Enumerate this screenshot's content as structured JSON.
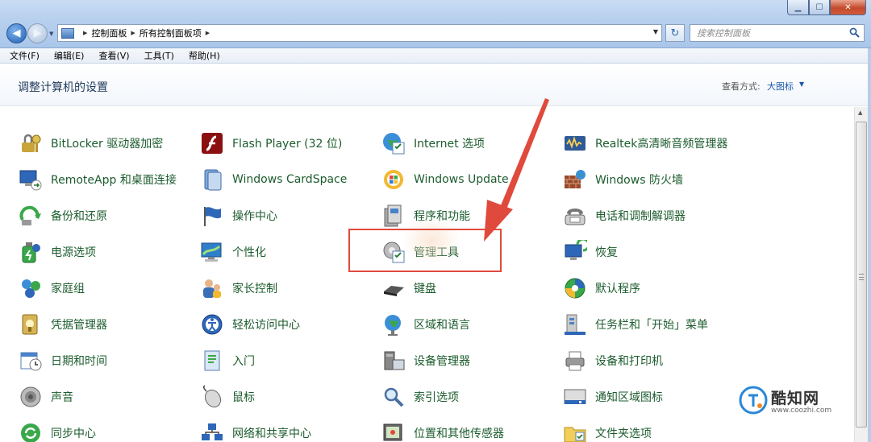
{
  "window": {
    "minimize_glyph": "▁",
    "maximize_glyph": "☐",
    "close_glyph": "✕"
  },
  "address": {
    "crumbs": [
      "控制面板",
      "所有控制面板项"
    ],
    "search_placeholder": "搜索控制面板"
  },
  "menu": [
    "文件(F)",
    "编辑(E)",
    "查看(V)",
    "工具(T)",
    "帮助(H)"
  ],
  "header": {
    "title": "调整计算机的设置",
    "view_by_label": "查看方式:",
    "view_by_value": "大图标"
  },
  "items": [
    {
      "label": "BitLocker 驱动器加密",
      "icon": "bitlocker-icon"
    },
    {
      "label": "Flash Player (32 位)",
      "icon": "flash-player-icon"
    },
    {
      "label": "Internet 选项",
      "icon": "internet-options-icon"
    },
    {
      "label": "Realtek高清晰音频管理器",
      "icon": "realtek-audio-icon"
    },
    {
      "label": "RemoteApp 和桌面连接",
      "icon": "remoteapp-icon"
    },
    {
      "label": "Windows CardSpace",
      "icon": "cardspace-icon"
    },
    {
      "label": "Windows Update",
      "icon": "windows-update-icon"
    },
    {
      "label": "Windows 防火墙",
      "icon": "firewall-icon"
    },
    {
      "label": "备份和还原",
      "icon": "backup-restore-icon"
    },
    {
      "label": "操作中心",
      "icon": "action-center-icon"
    },
    {
      "label": "程序和功能",
      "icon": "programs-features-icon"
    },
    {
      "label": "电话和调制解调器",
      "icon": "phone-modem-icon"
    },
    {
      "label": "电源选项",
      "icon": "power-options-icon"
    },
    {
      "label": "个性化",
      "icon": "personalization-icon"
    },
    {
      "label": "管理工具",
      "icon": "admin-tools-icon"
    },
    {
      "label": "恢复",
      "icon": "recovery-icon"
    },
    {
      "label": "家庭组",
      "icon": "homegroup-icon"
    },
    {
      "label": "家长控制",
      "icon": "parental-controls-icon"
    },
    {
      "label": "键盘",
      "icon": "keyboard-icon"
    },
    {
      "label": "默认程序",
      "icon": "default-programs-icon"
    },
    {
      "label": "凭据管理器",
      "icon": "credential-manager-icon"
    },
    {
      "label": "轻松访问中心",
      "icon": "ease-of-access-icon"
    },
    {
      "label": "区域和语言",
      "icon": "region-language-icon"
    },
    {
      "label": "任务栏和「开始」菜单",
      "icon": "taskbar-start-icon"
    },
    {
      "label": "日期和时间",
      "icon": "date-time-icon"
    },
    {
      "label": "入门",
      "icon": "getting-started-icon"
    },
    {
      "label": "设备管理器",
      "icon": "device-manager-icon"
    },
    {
      "label": "设备和打印机",
      "icon": "devices-printers-icon"
    },
    {
      "label": "声音",
      "icon": "sound-icon"
    },
    {
      "label": "鼠标",
      "icon": "mouse-icon"
    },
    {
      "label": "索引选项",
      "icon": "indexing-options-icon"
    },
    {
      "label": "通知区域图标",
      "icon": "notification-area-icon"
    },
    {
      "label": "同步中心",
      "icon": "sync-center-icon"
    },
    {
      "label": "网络和共享中心",
      "icon": "network-sharing-icon"
    },
    {
      "label": "位置和其他传感器",
      "icon": "location-sensors-icon"
    },
    {
      "label": "文件夹选项",
      "icon": "folder-options-icon"
    }
  ],
  "watermark": {
    "name": "酷知网",
    "url": "www.coozhi.com"
  },
  "colors": {
    "item_text": "#1c5c2e",
    "highlight_border": "#e04a3c",
    "link_blue": "#1a5aa8"
  }
}
